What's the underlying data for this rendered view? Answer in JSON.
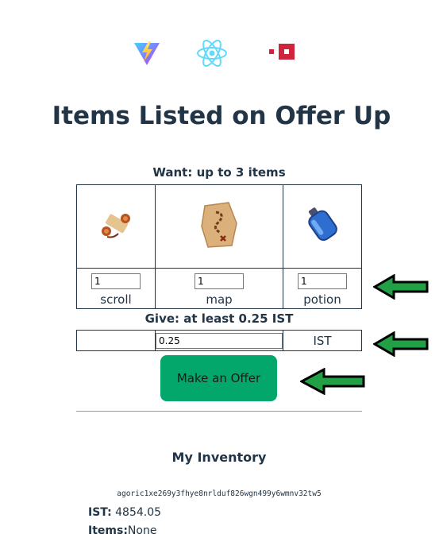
{
  "header": {
    "logos": [
      "vite-logo",
      "react-logo",
      "agoric-logo"
    ],
    "title": "Items Listed on Offer Up"
  },
  "want": {
    "heading": "Want: up to 3 items",
    "items": [
      {
        "name": "scroll",
        "icon": "scroll-icon",
        "quantity": "1"
      },
      {
        "name": "map",
        "icon": "treasure-map-icon",
        "quantity": "1"
      },
      {
        "name": "potion",
        "icon": "potion-bottle-icon",
        "quantity": "1"
      }
    ]
  },
  "give": {
    "heading": "Give: at least 0.25 IST",
    "amount": "0.25",
    "currency": "IST"
  },
  "offer_button": "Make an Offer",
  "inventory": {
    "heading": "My Inventory",
    "address": "agoric1xe269y3fhye8nrlduf826wgn499y6wmnv32tw5",
    "ist_label": "IST:",
    "ist_value": "4854.05",
    "items_label": "Items:",
    "items_value": "None"
  },
  "colors": {
    "button": "#04a76b",
    "text": "#213547",
    "arrow_fill": "#22a046",
    "agoric_red": "#d0243c"
  }
}
